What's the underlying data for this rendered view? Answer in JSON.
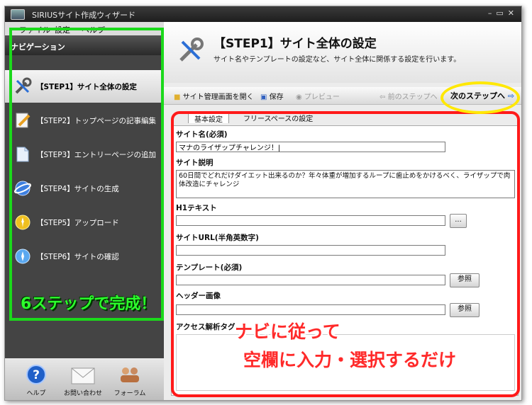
{
  "window": {
    "title": "SIRIUSサイト作成ウィザード"
  },
  "menu": {
    "file": "ファイル",
    "settings": "設定",
    "help": "ヘルプ"
  },
  "nav": {
    "header": "ナビゲーション",
    "items": [
      {
        "label": "【STEP1】サイト全体の設定",
        "icon": "tools-icon"
      },
      {
        "label": "【STEP2】トップページの記事編集",
        "icon": "pencil-document-icon"
      },
      {
        "label": "【STEP3】エントリーページの追加",
        "icon": "document-icon"
      },
      {
        "label": "【STEP4】サイトの生成",
        "icon": "globe-icon"
      },
      {
        "label": "【STEP5】アップロード",
        "icon": "upload-icon"
      },
      {
        "label": "【STEP6】サイトの確認",
        "icon": "browser-icon"
      }
    ]
  },
  "annotations": {
    "green": "6ステップで完成！",
    "red_line1": "ナビに従って",
    "red_line2": "空欄に入力・選択するだけ"
  },
  "bottom": {
    "help": "ヘルプ",
    "contact": "お問い合わせ",
    "forum": "フォーラム"
  },
  "step": {
    "title": "【STEP1】サイト全体の設定",
    "description": "サイト名やテンプレートの設定など、サイト全体に関係する設定を行います。"
  },
  "toolbar": {
    "open_admin": "サイト管理画面を開く",
    "save": "保存",
    "preview": "プレビュー",
    "prev_step": "前のステップへ",
    "next_step": "次のステップへ"
  },
  "tabs": {
    "basic": "基本設定",
    "freespace": "フリースペースの設定"
  },
  "form": {
    "site_name_label": "サイト名(必須)",
    "site_name_value": "マナのライザップチャレンジ！|",
    "site_desc_label": "サイト説明",
    "site_desc_value": "60日間でどれだけダイエット出来るのか？年々体重が増加するループに歯止めをかけるべく、ライザップで肉体改造にチャレンジ",
    "h1_label": "H1テキスト",
    "h1_button": "...",
    "url_label": "サイトURL(半角英数字)",
    "template_label": "テンプレート(必須)",
    "browse": "参照",
    "header_image_label": "ヘッダー画像",
    "analytics_label": "アクセス解析タグ"
  }
}
